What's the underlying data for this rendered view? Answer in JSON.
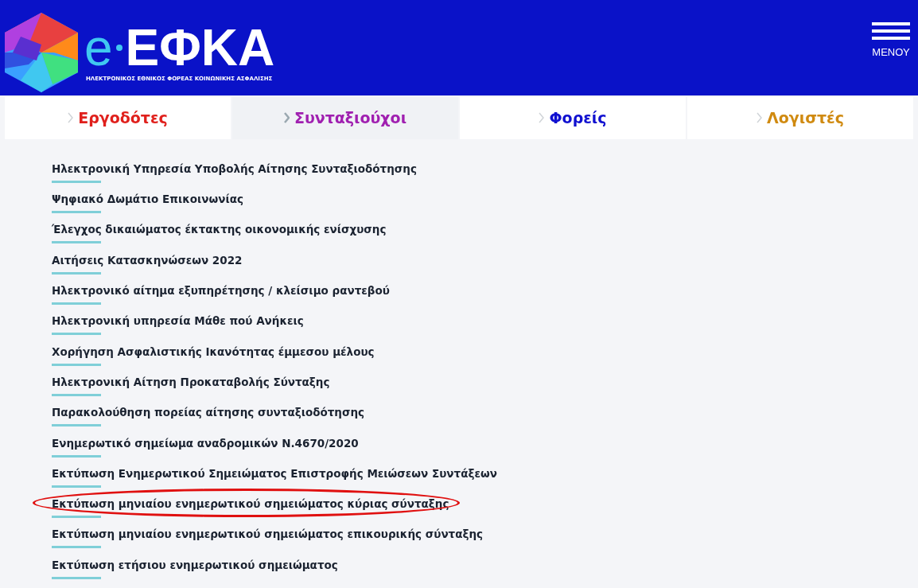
{
  "header": {
    "logo_prefix": "e",
    "logo_name": "ΕΦΚΑ",
    "logo_subtitle": "ΗΛΕΚΤΡΟΝΙΚΟΣ ΕΘΝΙΚΟΣ ΦΟΡΕΑΣ ΚΟΙΝΩΝΙΚΗΣ ΑΣΦΑΛΙΣΗΣ",
    "menu_label": "ΜΕΝΟΥ"
  },
  "tabs": [
    {
      "label": "Εργοδότες",
      "selected": false,
      "color": "#e0201c"
    },
    {
      "label": "Συνταξιούχοι",
      "selected": true,
      "color": "#a020b0"
    },
    {
      "label": "Φορείς",
      "selected": false,
      "color": "#1010d0"
    },
    {
      "label": "Λογιστές",
      "selected": false,
      "color": "#d08a10"
    }
  ],
  "links": [
    {
      "label": "Ηλεκτρονική Υπηρεσία Υποβολής Αίτησης Συνταξιοδότησης",
      "highlighted": false
    },
    {
      "label": "Ψηφιακό Δωμάτιο Επικοινωνίας",
      "highlighted": false
    },
    {
      "label": "Έλεγχος δικαιώματος έκτακτης οικονομικής ενίσχυσης",
      "highlighted": false
    },
    {
      "label": "Αιτήσεις Κατασκηνώσεων 2022",
      "highlighted": false
    },
    {
      "label": "Ηλεκτρονικό αίτημα εξυπηρέτησης / κλείσιμο ραντεβού",
      "highlighted": false
    },
    {
      "label": "Ηλεκτρονική υπηρεσία Μάθε πού Ανήκεις",
      "highlighted": false
    },
    {
      "label": "Χορήγηση Ασφαλιστικής Ικανότητας έμμεσου μέλους",
      "highlighted": false
    },
    {
      "label": "Ηλεκτρονική Αίτηση Προκαταβολής Σύνταξης",
      "highlighted": false
    },
    {
      "label": "Παρακολούθηση πορείας αίτησης συνταξιοδότησης",
      "highlighted": false
    },
    {
      "label": "Ενημερωτικό σημείωμα αναδρομικών Ν.4670/2020",
      "highlighted": false
    },
    {
      "label": "Εκτύπωση Ενημερωτικού Σημειώματος Επιστροφής Μειώσεων Συντάξεων",
      "highlighted": false
    },
    {
      "label": "Εκτύπωση μηνιαίου ενημερωτικού σημειώματος κύριας σύνταξης",
      "highlighted": true
    },
    {
      "label": "Εκτύπωση μηνιαίου ενημερωτικού σημειώματος επικουρικής σύνταξης",
      "highlighted": false
    },
    {
      "label": "Εκτύπωση ετήσιου ενημερωτικού σημειώματος",
      "highlighted": false
    }
  ]
}
